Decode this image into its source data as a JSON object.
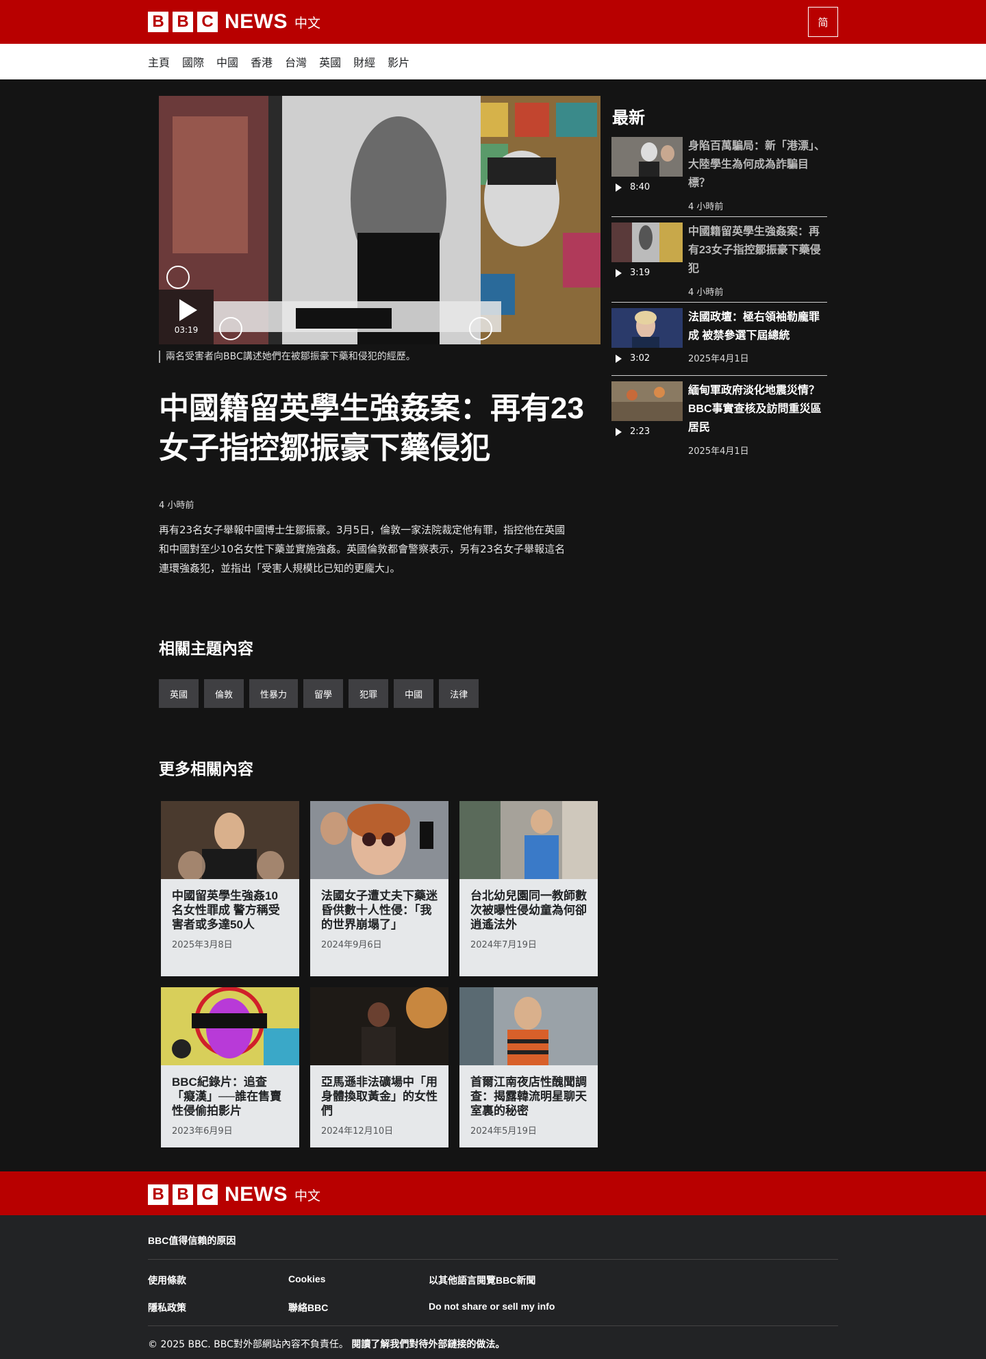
{
  "brand": {
    "bbc": [
      "B",
      "B",
      "C"
    ],
    "news": "NEWS",
    "lang": "中文"
  },
  "lang_toggle": "简",
  "nav": [
    "主頁",
    "國際",
    "中國",
    "香港",
    "台灣",
    "英國",
    "財經",
    "影片"
  ],
  "hero": {
    "duration": "03:19",
    "caption": "兩名受害者向BBC講述她們在被鄒振豪下藥和侵犯的經歷。",
    "headline": "中國籍留英學生強姦案：再有23女子指控鄒振豪下藥侵犯",
    "timestamp": "4 小時前",
    "summary": "再有23名女子舉報中國博士生鄒振豪。3月5日，倫敦一家法院裁定他有罪，指控他在英國和中國對至少10名女性下藥並實施強姦。英國倫敦都會警察表示，另有23名女子舉報這名連環強姦犯，並指出「受害人規模比已知的更龐大」。"
  },
  "topics": {
    "title": "相關主題內容",
    "tags": [
      "英國",
      "倫敦",
      "性暴力",
      "留學",
      "犯罪",
      "中國",
      "法律"
    ]
  },
  "more": {
    "title": "更多相關內容",
    "cards": [
      {
        "title": "中國留英學生強姦10名女性罪成 警方稱受害者或多達50人",
        "date": "2025年3月8日"
      },
      {
        "title": "法國女子遭丈夫下藥迷昏供數十人性侵：「我的世界崩塌了」",
        "date": "2024年9月6日"
      },
      {
        "title": "台北幼兒園同一教師數次被曝性侵幼童為何卻逍遙法外",
        "date": "2024年7月19日"
      },
      {
        "title": "BBC紀錄片：追查「癡漢」──誰在售賣性侵偷拍影片",
        "date": "2023年6月9日"
      },
      {
        "title": "亞馬遜非法礦場中「用身體換取黃金」的女性們",
        "date": "2024年12月10日"
      },
      {
        "title": "首爾江南夜店性醜聞調查：揭露韓流明星聊天室裏的秘密",
        "date": "2024年5月19日"
      }
    ]
  },
  "latest": {
    "title": "最新",
    "items": [
      {
        "title": "身陷百萬騙局：新「港漂」、大陸學生為何成為詐騙目標？",
        "duration": "8:40",
        "date": "4 小時前"
      },
      {
        "title": "中國籍留英學生強姦案：再有23女子指控鄒振豪下藥侵犯",
        "duration": "3:19",
        "date": "4 小時前"
      },
      {
        "title": "法國政壇：極右領袖勒龐罪成 被禁參選下屆總統",
        "duration": "3:02",
        "date": "2025年4月1日"
      },
      {
        "title": "緬甸軍政府淡化地震災情？BBC事實查核及訪問重災區居民",
        "duration": "2:23",
        "date": "2025年4月1日"
      }
    ]
  },
  "footer": {
    "trust": "BBC值得信賴的原因",
    "links": [
      "使用條款",
      "Cookies",
      "以其他語言閱覽BBC新聞",
      "隱私政策",
      "聯絡BBC",
      "Do not share or sell my info"
    ],
    "copyright": "© 2025 BBC. BBC對外部網站內容不負責任。",
    "external": "閱讀了解我們對待外部鏈接的做法。"
  },
  "colors": {
    "brand_red": "#b80000",
    "page_bg": "#141414",
    "footer_bg": "#222325"
  }
}
